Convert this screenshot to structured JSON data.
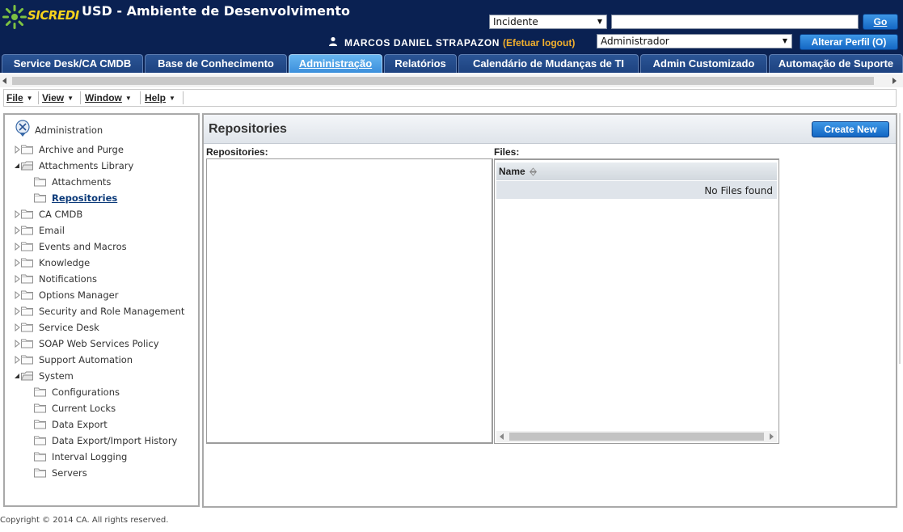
{
  "header": {
    "logo_text": "SICREDI",
    "title": "USD - Ambiente de Desenvolvimento",
    "search_type": "Incidente",
    "search_value": "",
    "go_label": "Go",
    "user_name": "MARCOS DANIEL STRAPAZON",
    "logout_label": "(Efetuar logout)",
    "role": "Administrador",
    "profile_button": "Alterar Perfil (O)"
  },
  "tabs": [
    {
      "label": "Service Desk/CA CMDB",
      "active": false
    },
    {
      "label": "Base de Conhecimento",
      "active": false
    },
    {
      "label": "Administração",
      "active": true
    },
    {
      "label": "Relatórios",
      "active": false
    },
    {
      "label": "Calendário de Mudanças de TI",
      "active": false
    },
    {
      "label": "Admin Customizado",
      "active": false
    },
    {
      "label": "Automação de Suporte",
      "active": false
    }
  ],
  "menu": [
    {
      "label": "File"
    },
    {
      "label": "View"
    },
    {
      "label": "Window"
    },
    {
      "label": "Help"
    }
  ],
  "tree": {
    "root": "Administration",
    "items": [
      {
        "label": "Archive and Purge",
        "level": 0,
        "expanded": false
      },
      {
        "label": "Attachments Library",
        "level": 0,
        "expanded": true
      },
      {
        "label": "Attachments",
        "level": 1
      },
      {
        "label": "Repositories",
        "level": 1,
        "selected": true
      },
      {
        "label": "CA CMDB",
        "level": 0,
        "expanded": false
      },
      {
        "label": "Email",
        "level": 0,
        "expanded": false
      },
      {
        "label": "Events and Macros",
        "level": 0,
        "expanded": false
      },
      {
        "label": "Knowledge",
        "level": 0,
        "expanded": false
      },
      {
        "label": "Notifications",
        "level": 0,
        "expanded": false
      },
      {
        "label": "Options Manager",
        "level": 0,
        "expanded": false
      },
      {
        "label": "Security and Role Management",
        "level": 0,
        "expanded": false
      },
      {
        "label": "Service Desk",
        "level": 0,
        "expanded": false
      },
      {
        "label": "SOAP Web Services Policy",
        "level": 0,
        "expanded": false
      },
      {
        "label": "Support Automation",
        "level": 0,
        "expanded": false
      },
      {
        "label": "System",
        "level": 0,
        "expanded": true
      },
      {
        "label": "Configurations",
        "level": 1
      },
      {
        "label": "Current Locks",
        "level": 1
      },
      {
        "label": "Data Export",
        "level": 1
      },
      {
        "label": "Data Export/Import History",
        "level": 1
      },
      {
        "label": "Interval Logging",
        "level": 1
      },
      {
        "label": "Servers",
        "level": 1
      }
    ]
  },
  "panel": {
    "title": "Repositories",
    "create_button": "Create New",
    "repositories_label": "Repositories:",
    "files_label": "Files:",
    "files_column": "Name",
    "files_empty": "No Files found"
  },
  "footer": {
    "copyright": "Copyright © 2014 CA. All rights reserved."
  },
  "colors": {
    "header_bg": "#0a2152",
    "tab_active": "#3b8fdc",
    "button_blue": "#1467c4",
    "logout": "#f2b02d"
  }
}
